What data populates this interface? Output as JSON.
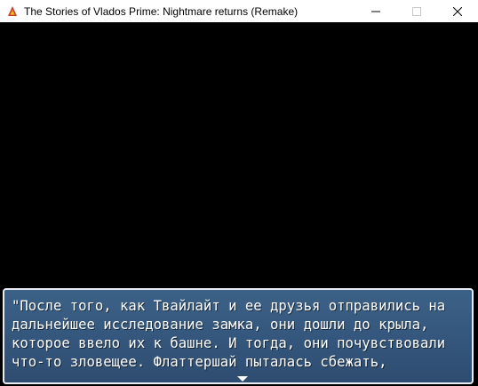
{
  "window": {
    "title": "The Stories of Vlados Prime: Nightmare returns (Remake)",
    "icon": "rpg-maker-app-icon",
    "controls": {
      "minimize_icon": "minimize-icon",
      "maximize_icon": "maximize-icon",
      "close_icon": "close-icon"
    }
  },
  "message": {
    "lines": [
      "\"После того, как Твайлайт и ее друзья отправились на",
      "дальнейшее исследование замка, они дошли до крыла,",
      "которое ввело их к башне. И тогда, они почувствовали",
      "что-то зловещее. Флаттершай пыталась сбежать,"
    ],
    "continue_indicator_icon": "down-arrow-icon"
  },
  "colors": {
    "game_background": "#000000",
    "message_box": "#3c6187",
    "message_border": "#e8ecf2",
    "text": "#ffffff"
  }
}
